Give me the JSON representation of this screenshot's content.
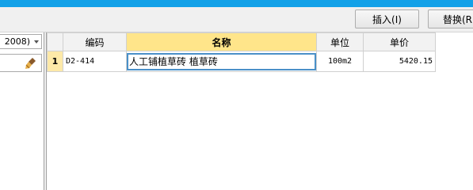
{
  "toolbar": {
    "insert_label": "插入(I)",
    "replace_label": "替换(R"
  },
  "left_panel": {
    "combo_value": "2008)",
    "brush_icon": "brush-icon"
  },
  "grid": {
    "columns": [
      "",
      "编码",
      "名称",
      "单位",
      "单价"
    ],
    "active_column": "名称",
    "rows": [
      {
        "row_no": "1",
        "code": "D2-414",
        "name": "人工铺植草砖 植草砖",
        "unit": "100m2",
        "price": "5420.15"
      }
    ]
  },
  "colors": {
    "title_bar": "#13a1e8",
    "active_header": "#ffe58a",
    "row_number_bg": "#fde9a8",
    "edit_border": "#4a90c8"
  }
}
